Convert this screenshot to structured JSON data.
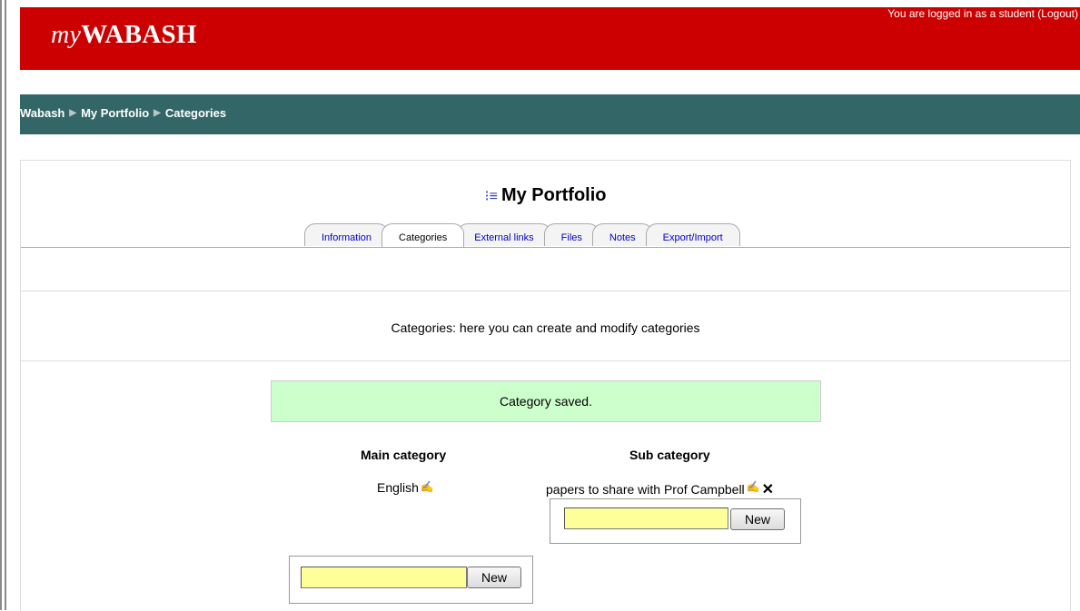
{
  "header": {
    "logo_prefix": "my",
    "logo_main": "WABASH",
    "login_text": "You are logged in as a student",
    "logout_label": "(Logout)"
  },
  "breadcrumb": [
    "Wabash",
    "My Portfolio",
    "Categories"
  ],
  "page": {
    "title": "My Portfolio",
    "tabs": [
      "Information",
      "Categories",
      "External links",
      "Files",
      "Notes",
      "Export/Import"
    ],
    "active_tab": "Categories",
    "info_text": "Categories: here you can create and modify categories",
    "notice": "Category saved."
  },
  "table": {
    "main_header": "Main category",
    "sub_header": "Sub category",
    "main_item": "English",
    "sub_item": "papers to share with Prof Campbell"
  },
  "forms": {
    "sub_new_value": "",
    "sub_new_label": "New",
    "main_new_value": "",
    "main_new_label": "New"
  },
  "icons": {
    "edit": "edit-pencil-icon",
    "delete": "delete-x-icon",
    "title_icon": "list-icon",
    "breadcrumb_separator": "triangle-right"
  },
  "colors": {
    "header_bg": "#cc0000",
    "nav_bg": "#336666",
    "notice_bg": "#ccffcc",
    "input_bg": "#ffff99",
    "link": "#0000cc"
  }
}
